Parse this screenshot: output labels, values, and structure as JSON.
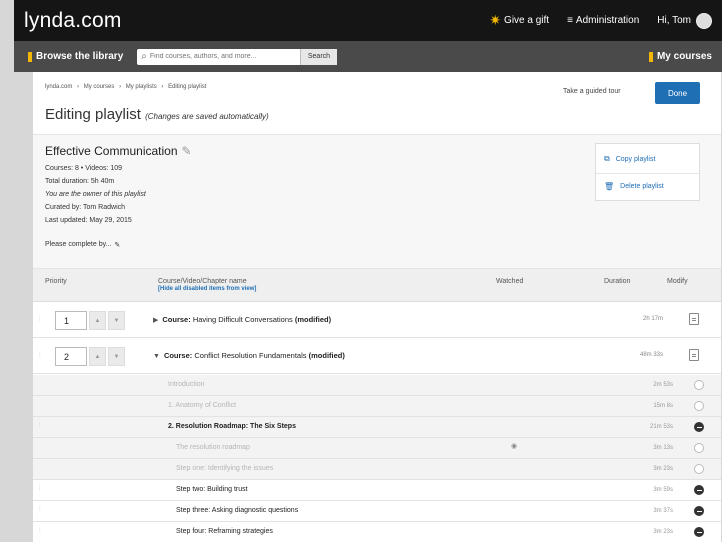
{
  "header": {
    "logo": "lynda.com",
    "give_gift": "Give a gift",
    "administration": "Administration",
    "greeting": "Hi, Tom"
  },
  "nav": {
    "browse": "Browse the library",
    "search_placeholder": "Find courses, authors, and more...",
    "search_button": "Search",
    "my_courses": "My courses"
  },
  "breadcrumb": [
    "lynda.com",
    "My courses",
    "My playlists",
    "Editing playlist"
  ],
  "breadcrumb_sep": "›",
  "guided_tour": "Take a guided tour",
  "done": "Done",
  "page_title": "Editing playlist",
  "page_subtitle": "(Changes are saved automatically)",
  "playlist": {
    "name": "Effective Communication",
    "counts": "Courses: 8 • Videos: 109",
    "duration": "Total duration: 5h 40m",
    "owner": "You are the owner of this playlist",
    "curated": "Curated by: Tom Radwich",
    "updated": "Last updated: May 29, 2015",
    "complete_by": "Please complete by..."
  },
  "actions": {
    "copy": "Copy playlist",
    "delete": "Delete playlist"
  },
  "table": {
    "col_priority": "Priority",
    "col_name": "Course/Video/Chapter name",
    "hide_disabled": "[Hide all disabled items from view]",
    "col_watched": "Watched",
    "col_duration": "Duration",
    "col_modify": "Modify"
  },
  "courses": [
    {
      "priority": "1",
      "prefix": "Course:",
      "title": "Having Difficult Conversations",
      "tag": "(modified)",
      "duration": "2h 17m"
    },
    {
      "priority": "2",
      "prefix": "Course:",
      "title": "Conflict Resolution Fundamentals",
      "tag": "(modified)",
      "duration": "48m 33s"
    }
  ],
  "items": [
    {
      "name": "Introduction",
      "duration": "2m 53s"
    },
    {
      "name": "1. Anatomy of Conflict",
      "duration": "15m 8s"
    },
    {
      "name": "2. Resolution Roadmap: The Six Steps",
      "duration": "21m 53s"
    },
    {
      "name": "The resolution roadmap",
      "duration": "3m 13s"
    },
    {
      "name": "Step one: Identifying the issues",
      "duration": "3m 23s"
    },
    {
      "name": "Step two: Building trust",
      "duration": "3m 59s"
    },
    {
      "name": "Step three: Asking diagnostic questions",
      "duration": "3m 37s"
    },
    {
      "name": "Step four: Reframing strategies",
      "duration": "3m 23s"
    }
  ],
  "icons": {
    "gift": "gift-icon",
    "admin": "menu-icon",
    "search": "search-icon",
    "pencil": "pencil-icon",
    "copy": "copy-icon",
    "delete": "trash-icon",
    "modify": "note-icon",
    "eye": "eye-icon"
  },
  "colors": {
    "accent": "#1f6fb5",
    "brand_yellow": "#f2b705",
    "topbar": "#151515",
    "navbar": "#4a4a4a"
  }
}
